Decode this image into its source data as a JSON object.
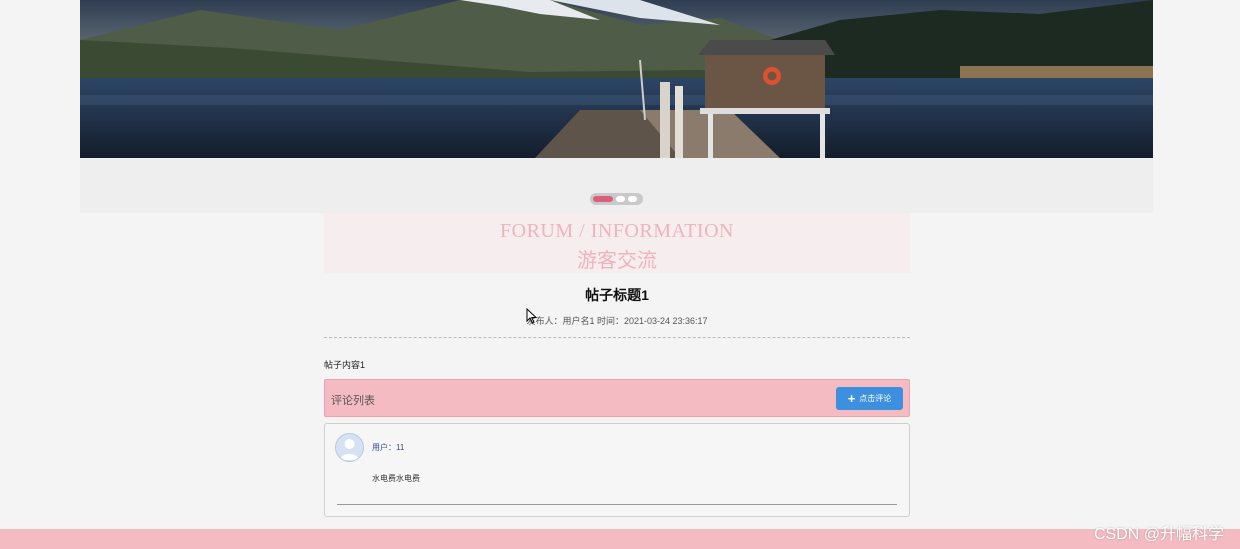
{
  "banner": {
    "slide_count": 3,
    "active_slide": 1
  },
  "section": {
    "title_en": "FORUM / INFORMATION",
    "title_cn": "游客交流"
  },
  "post": {
    "title": "帖子标题1",
    "meta": "发布人：用户名1 时间：2021-03-24 23:36:17",
    "content": "帖子内容1"
  },
  "comments": {
    "header": "评论列表",
    "add_button": "点击评论",
    "items": [
      {
        "user": "用户：11",
        "text": "水电费水电费"
      }
    ]
  },
  "watermark": "CSDN @升幅科学",
  "colors": {
    "accent_pink": "#f4bcc2",
    "button_blue": "#3d8fe0",
    "heading_pink": "#efb3bd"
  }
}
